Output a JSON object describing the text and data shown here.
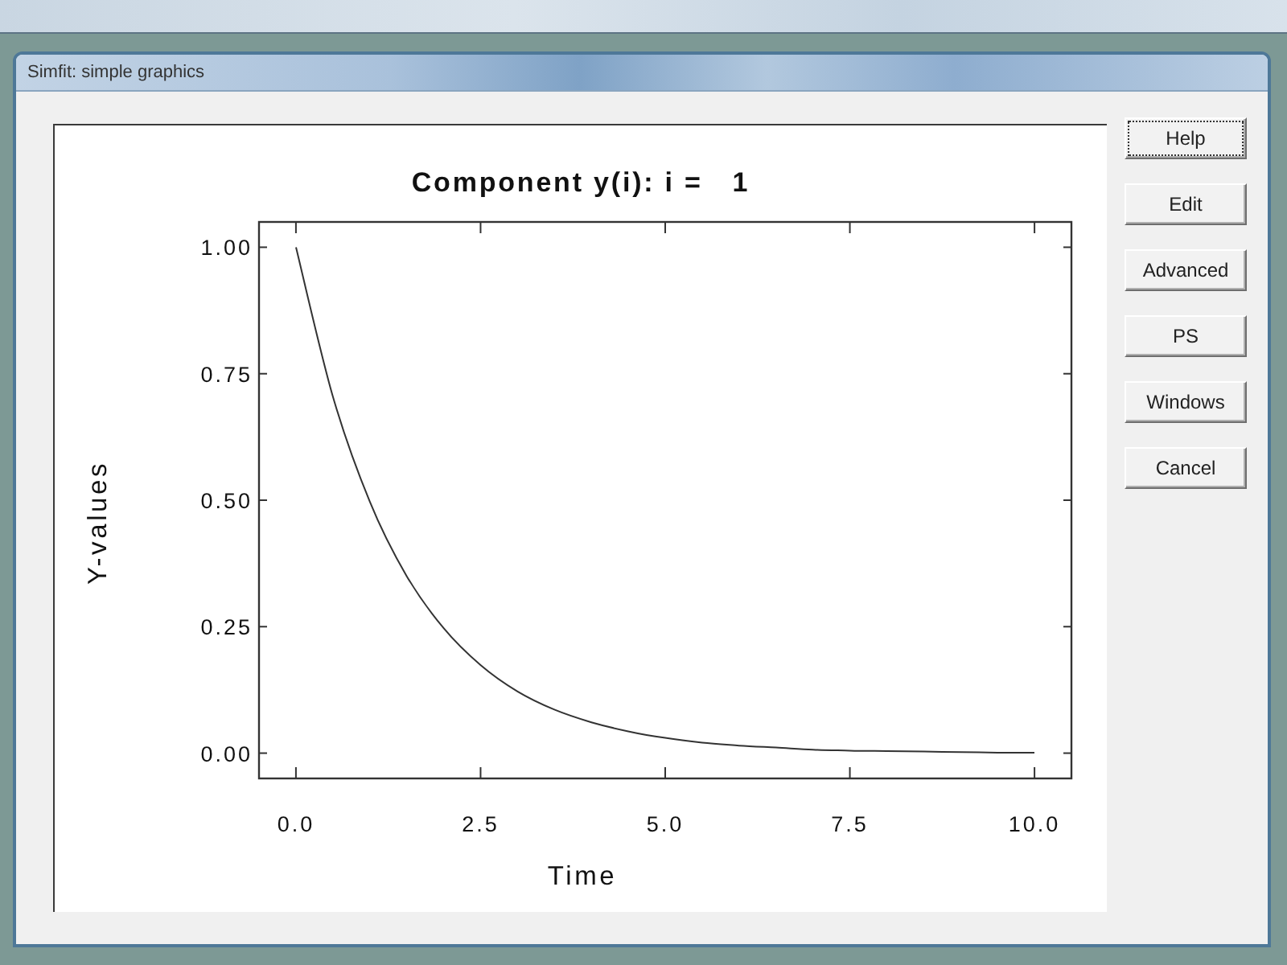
{
  "window": {
    "title": "Simfit: simple graphics"
  },
  "plot": {
    "chart_data": {
      "type": "line",
      "title": "Component y(i): i =   1",
      "xlabel": "Time",
      "ylabel": "Y-values",
      "x": [
        0,
        0.5,
        1,
        1.5,
        2,
        2.5,
        3,
        3.5,
        4,
        4.5,
        5,
        5.5,
        6,
        6.5,
        7,
        7.5,
        8,
        8.5,
        9,
        9.5,
        10
      ],
      "values": [
        1.0,
        0.705,
        0.497,
        0.35,
        0.247,
        0.174,
        0.122,
        0.086,
        0.061,
        0.043,
        0.03,
        0.021,
        0.015,
        0.011,
        0.007,
        0.005,
        0.004,
        0.003,
        0.002,
        0.001,
        0.001
      ],
      "xlim": [
        -0.5,
        10.5
      ],
      "ylim": [
        -0.05,
        1.05
      ],
      "xticks": [
        {
          "value": 0,
          "label": "0.0"
        },
        {
          "value": 2.5,
          "label": "2.5"
        },
        {
          "value": 5,
          "label": "5.0"
        },
        {
          "value": 7.5,
          "label": "7.5"
        },
        {
          "value": 10,
          "label": "10.0"
        }
      ],
      "yticks": [
        {
          "value": 0,
          "label": "0.00"
        },
        {
          "value": 0.25,
          "label": "0.25"
        },
        {
          "value": 0.5,
          "label": "0.50"
        },
        {
          "value": 0.75,
          "label": "0.75"
        },
        {
          "value": 1,
          "label": "1.00"
        }
      ]
    }
  },
  "buttons": [
    {
      "label": "Help",
      "focused": true
    },
    {
      "label": "Edit",
      "focused": false
    },
    {
      "label": "Advanced",
      "focused": false
    },
    {
      "label": "PS",
      "focused": false
    },
    {
      "label": "Windows",
      "focused": false
    },
    {
      "label": "Cancel",
      "focused": false
    }
  ]
}
